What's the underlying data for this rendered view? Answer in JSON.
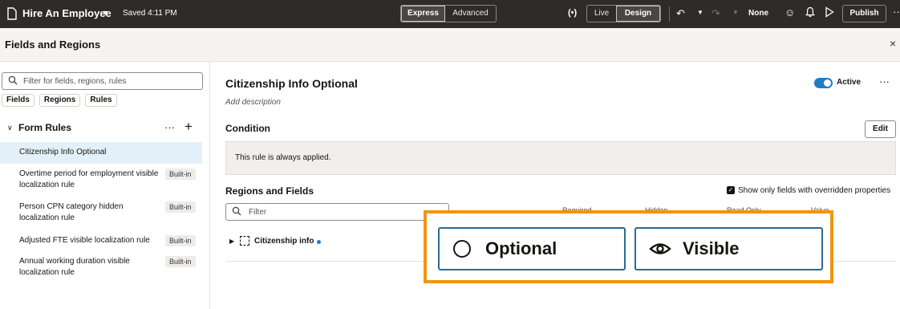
{
  "topbar": {
    "title": "Hire An Employee",
    "saved": "Saved 4:11 PM",
    "mode_options": [
      "Express",
      "Advanced"
    ],
    "mode_selected": "Express",
    "bracket_icon": "(•)",
    "view_options": [
      "Live",
      "Design"
    ],
    "view_selected": "Design",
    "none_label": "None",
    "publish_label": "Publish",
    "more_label": "··"
  },
  "panel": {
    "title": "Fields and Regions",
    "close_label": "×"
  },
  "left": {
    "search_placeholder": "Filter for fields, regions, rules",
    "chips": [
      "Fields",
      "Regions",
      "Rules"
    ],
    "form_rules_title": "Form Rules",
    "form_rules_more": "···",
    "form_rules_add": "+",
    "rules": [
      {
        "label": "Citizenship Info Optional",
        "badge": ""
      },
      {
        "label": "Overtime period for employment visible localization rule",
        "badge": "Built-in"
      },
      {
        "label": "Person CPN category hidden localization rule",
        "badge": "Built-in"
      },
      {
        "label": "Adjusted FTE visible localization rule",
        "badge": "Built-in"
      },
      {
        "label": "Annual working duration visible localization rule",
        "badge": "Built-in"
      }
    ]
  },
  "main": {
    "title": "Citizenship Info Optional",
    "description": "Add description",
    "active_label": "Active",
    "more_label": "···",
    "condition_heading": "Condition",
    "edit_label": "Edit",
    "condition_text": "This rule is always applied.",
    "regions_heading": "Regions and Fields",
    "show_only_label": "Show only fields with overridden properties",
    "filter_placeholder": "Filter",
    "column_headers": [
      "Required",
      "Hidden",
      "Read Only",
      "Value"
    ],
    "region_row_label": "Citizenship info"
  },
  "callout": {
    "optional_label": "Optional",
    "visible_label": "Visible"
  },
  "colors": {
    "topbar_bg": "#2e2b28",
    "accent": "#227bbf",
    "callout_border": "#f0950e",
    "pill_border": "#2c6a8f"
  }
}
